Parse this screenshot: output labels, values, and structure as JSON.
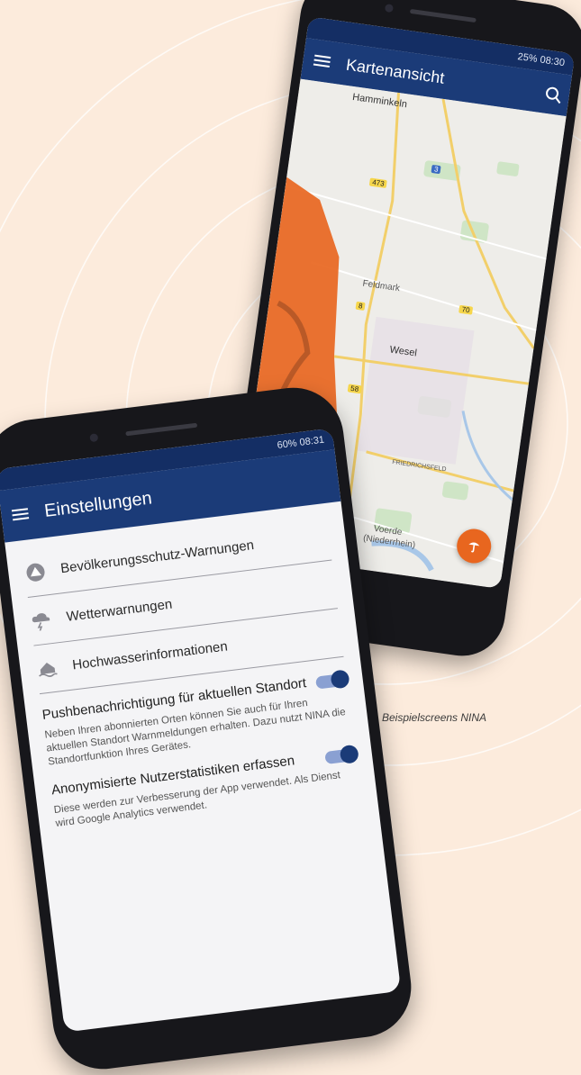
{
  "background_color": "#fcebdc",
  "caption": "Beispielscreens NINA",
  "colors": {
    "app_bar": "#1b3b78",
    "warning_area": "#e8661f",
    "toggle_on": "#1b3b78"
  },
  "map_screen": {
    "status": "25% 08:30",
    "title": "Kartenansicht",
    "search_icon": "search-icon",
    "labels": {
      "hamminkeln": "Hamminkeln",
      "feldmark": "Feldmark",
      "wesel": "Wesel",
      "friedrichsfeld": "FRIEDRICHSFELD",
      "voerde": "Voerde",
      "niederrhein": "(Niederrhein)",
      "road_473": "473",
      "road_3": "3",
      "road_70": "70",
      "road_8": "8",
      "road_58": "58"
    },
    "fab_icon": "storm-warning-icon"
  },
  "settings_screen": {
    "status": "60% 08:31",
    "title": "Einstellungen",
    "menu": [
      {
        "label": "Bevölkerungsschutz-Warnungen",
        "icon": "triangle-warning-icon"
      },
      {
        "label": "Wetterwarnungen",
        "icon": "thunder-cloud-icon"
      },
      {
        "label": "Hochwasserinformationen",
        "icon": "flood-house-icon"
      }
    ],
    "settings": [
      {
        "title": "Pushbenachrichtigung für aktuellen Standort",
        "description": "Neben Ihren abonnierten Orten können Sie auch für Ihren aktuellen Standort Warnmeldungen erhalten. Dazu nutzt NINA die Standortfunktion Ihres Gerätes.",
        "enabled": true
      },
      {
        "title": "Anonymisierte Nutzerstatistiken erfassen",
        "description": "Diese werden zur Verbesserung der App verwendet. Als Dienst wird Google Analytics verwendet.",
        "enabled": true
      }
    ]
  }
}
